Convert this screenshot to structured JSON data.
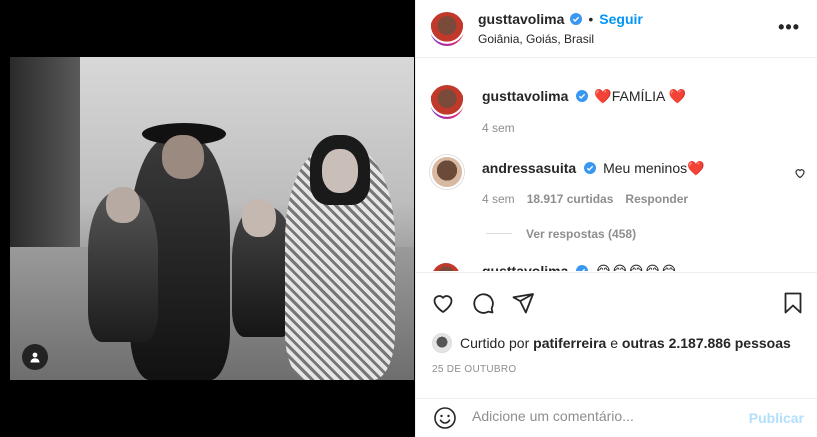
{
  "header": {
    "username": "gusttavolima",
    "separator": "•",
    "follow_label": "Seguir",
    "location": "Goiânia, Goiás, Brasil",
    "more_label": "•••"
  },
  "caption": {
    "username": "gusttavolima",
    "text": "❤️FAMÍLIA ❤️",
    "time": "4 sem"
  },
  "comments": [
    {
      "username": "andressasuita",
      "text": "Meu meninos❤️",
      "time": "4 sem",
      "likes": "18.917 curtidas",
      "reply_label": "Responder",
      "view_replies_label": "Ver respostas (458)"
    },
    {
      "username": "gusttavolima",
      "text": "😂😂😂😂😂"
    }
  ],
  "likes": {
    "prefix": "Curtido por",
    "user": "patiferreira",
    "connector": "e",
    "others": "outras 2.187.886 pessoas"
  },
  "date": "25 DE OUTUBRO",
  "add_comment": {
    "placeholder": "Adicione um comentário...",
    "publish_label": "Publicar"
  },
  "icons": [
    "heart-icon",
    "comment-icon",
    "share-icon",
    "bookmark-icon",
    "emoji-icon",
    "user-tag-icon",
    "more-icon",
    "verified-icon",
    "like-comment-icon"
  ],
  "colors": {
    "accent": "#0095f6",
    "publish_disabled": "#b2dffc",
    "verified": "#3897f0",
    "text_secondary": "#8e8e8e"
  }
}
